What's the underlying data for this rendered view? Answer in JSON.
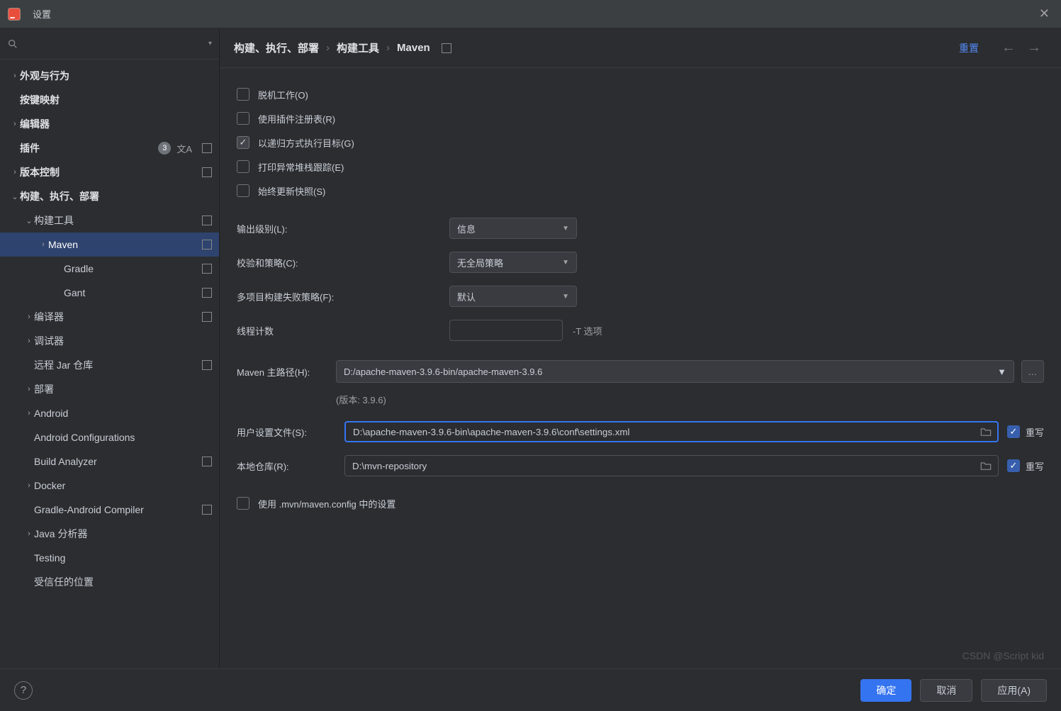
{
  "titlebar": {
    "title": "设置"
  },
  "sidebar": {
    "items": [
      {
        "label": "外观与行为",
        "depth": 0,
        "arrow": ">",
        "bold": true
      },
      {
        "label": "按键映射",
        "depth": 0,
        "arrow": "",
        "bold": true
      },
      {
        "label": "编辑器",
        "depth": 0,
        "arrow": ">",
        "bold": true
      },
      {
        "label": "插件",
        "depth": 0,
        "arrow": "",
        "bold": true,
        "badge": "3",
        "lang": true,
        "mod": true
      },
      {
        "label": "版本控制",
        "depth": 0,
        "arrow": ">",
        "bold": true,
        "mod": true
      },
      {
        "label": "构建、执行、部署",
        "depth": 0,
        "arrow": "v",
        "bold": true
      },
      {
        "label": "构建工具",
        "depth": 1,
        "arrow": "v",
        "mod": true
      },
      {
        "label": "Maven",
        "depth": 2,
        "arrow": ">",
        "selected": true,
        "mod": true
      },
      {
        "label": "Gradle",
        "depth": 3,
        "mod": true
      },
      {
        "label": "Gant",
        "depth": 3,
        "mod": true
      },
      {
        "label": "编译器",
        "depth": 1,
        "arrow": ">",
        "mod": true
      },
      {
        "label": "调试器",
        "depth": 1,
        "arrow": ">"
      },
      {
        "label": "远程 Jar 仓库",
        "depth": 1,
        "mod": true
      },
      {
        "label": "部署",
        "depth": 1,
        "arrow": ">"
      },
      {
        "label": "Android",
        "depth": 1,
        "arrow": ">"
      },
      {
        "label": "Android Configurations",
        "depth": 1
      },
      {
        "label": "Build Analyzer",
        "depth": 1,
        "mod": true
      },
      {
        "label": "Docker",
        "depth": 1,
        "arrow": ">"
      },
      {
        "label": "Gradle-Android Compiler",
        "depth": 1,
        "mod": true
      },
      {
        "label": "Java 分析器",
        "depth": 1,
        "arrow": ">"
      },
      {
        "label": "Testing",
        "depth": 1
      },
      {
        "label": "受信任的位置",
        "depth": 1
      }
    ]
  },
  "breadcrumb": {
    "a": "构建、执行、部署",
    "b": "构建工具",
    "c": "Maven"
  },
  "reset": "重置",
  "checks": {
    "offline": {
      "label": "脱机工作(O)",
      "checked": false
    },
    "registry": {
      "label": "使用插件注册表(R)",
      "checked": false
    },
    "recursive": {
      "label": "以递归方式执行目标(G)",
      "checked": true
    },
    "stack": {
      "label": "打印异常堆栈跟踪(E)",
      "checked": false
    },
    "snapshot": {
      "label": "始终更新快照(S)",
      "checked": false
    },
    "mvnconfig": {
      "label": "使用 .mvn/maven.config 中的设置",
      "checked": false
    }
  },
  "fields": {
    "output": {
      "label": "输出级别(L):",
      "value": "信息"
    },
    "checksum": {
      "label": "校验和策略(C):",
      "value": "无全局策略"
    },
    "mmfail": {
      "label": "多项目构建失败策略(F):",
      "value": "默认"
    },
    "threads": {
      "label": "线程计数",
      "value": "",
      "hint": "-T 选项"
    },
    "home": {
      "label": "Maven 主路径(H):",
      "value": "D:/apache-maven-3.9.6-bin/apache-maven-3.9.6"
    },
    "version": "(版本: 3.9.6)",
    "userSettings": {
      "label": "用户设置文件(S):",
      "value": "D:\\apache-maven-3.9.6-bin\\apache-maven-3.9.6\\conf\\settings.xml",
      "override": "重写",
      "overrideChecked": true
    },
    "localRepo": {
      "label": "本地仓库(R):",
      "value": "D:\\mvn-repository",
      "override": "重写",
      "overrideChecked": true
    }
  },
  "footer": {
    "ok": "确定",
    "cancel": "取消",
    "apply": "应用(A)"
  },
  "watermark": "CSDN @Script kid"
}
